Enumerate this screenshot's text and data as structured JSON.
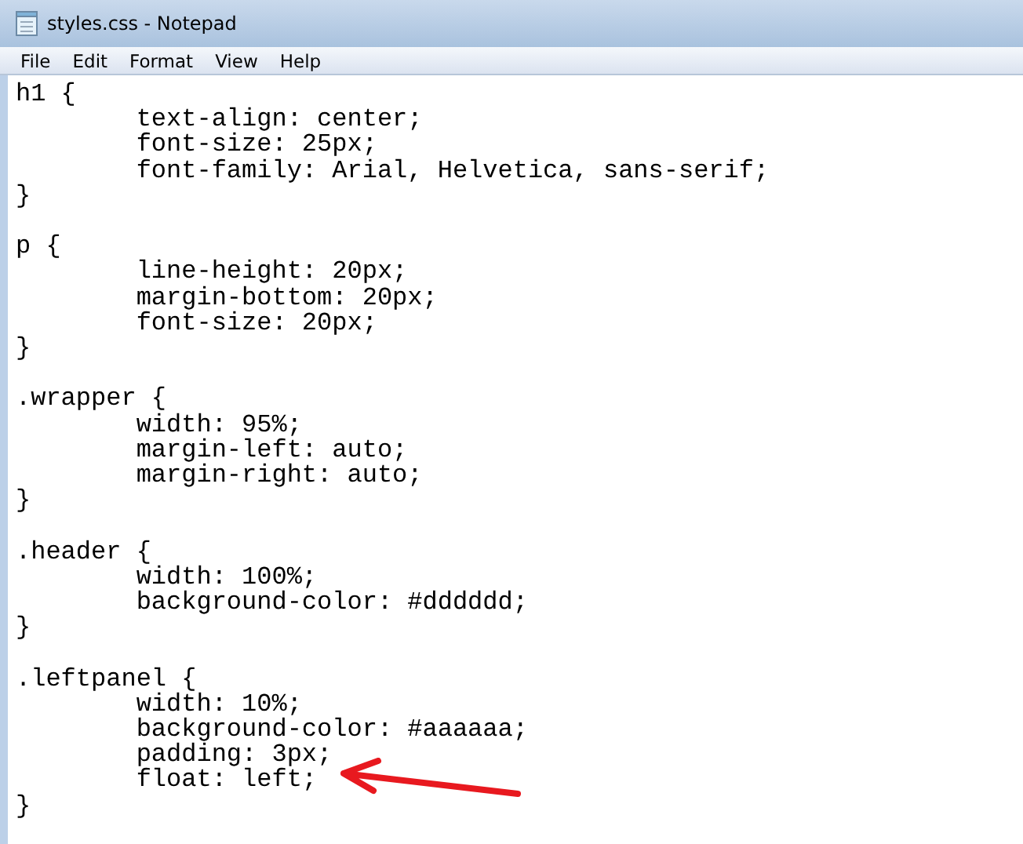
{
  "window": {
    "title": "styles.css - Notepad"
  },
  "menu": [
    "File",
    "Edit",
    "Format",
    "View",
    "Help"
  ],
  "editor": {
    "blocks": [
      [
        "h1 {",
        "\ttext-align: center;",
        "\tfont-size: 25px;",
        "\tfont-family: Arial, Helvetica, sans-serif;",
        "}"
      ],
      [
        "p {",
        "\tline-height: 20px;",
        "\tmargin-bottom: 20px;",
        "\tfont-size: 20px;",
        "}"
      ],
      [
        ".wrapper {",
        "\twidth: 95%;",
        "\tmargin-left: auto;",
        "\tmargin-right: auto;",
        "}"
      ],
      [
        ".header {",
        "\twidth: 100%;",
        "\tbackground-color: #dddddd;",
        "}"
      ],
      [
        ".leftpanel {",
        "\twidth: 10%;",
        "\tbackground-color: #aaaaaa;",
        "\tpadding: 3px;",
        "\tfloat: left;",
        "}"
      ]
    ]
  },
  "annotation": {
    "kind": "arrow",
    "color": "#e8191f"
  }
}
